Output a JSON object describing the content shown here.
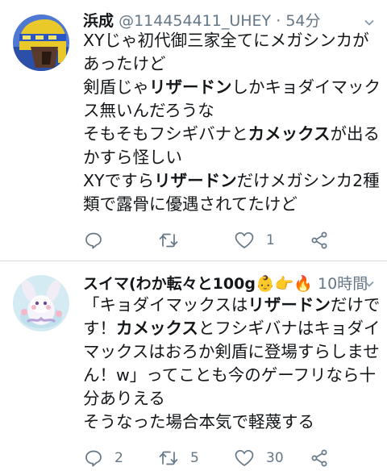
{
  "tweets": [
    {
      "name": "浜成",
      "handle": "@114454411_UHEY",
      "separator": "·",
      "time": "54分",
      "body_lines": [
        [
          {
            "t": "XYじゃ初代御三家全てにメガシンカが",
            "b": false
          }
        ],
        [
          {
            "t": "あったけど",
            "b": false
          }
        ],
        [
          {
            "t": "剣盾じゃ",
            "b": false
          },
          {
            "t": "リザードン",
            "b": true
          },
          {
            "t": "しかキョダイマック",
            "b": false
          }
        ],
        [
          {
            "t": "ス無いんだろうな",
            "b": false
          }
        ],
        [
          {
            "t": "そもそもフシギバナと",
            "b": false
          },
          {
            "t": "カメックス",
            "b": true
          },
          {
            "t": "が出る",
            "b": false
          }
        ],
        [
          {
            "t": "かすら怪しい",
            "b": false
          }
        ],
        [
          {
            "t": "XYですら",
            "b": false
          },
          {
            "t": "リザードン",
            "b": true
          },
          {
            "t": "だけメガシンカ2種",
            "b": false
          }
        ],
        [
          {
            "t": "類で露骨に優遇されてたけど",
            "b": false
          }
        ]
      ],
      "actions": {
        "reply_count": "",
        "retweet_count": "",
        "like_count": "1"
      },
      "avatar_icon": "masked-character-avatar-icon"
    },
    {
      "name": "スイマ(わか転々と100g",
      "name_emoji": [
        "👶",
        "👉",
        "🔥"
      ],
      "time": "10時間",
      "body_lines": [
        [
          {
            "t": "「キョダイマックスは",
            "b": false
          },
          {
            "t": "リザードン",
            "b": true
          },
          {
            "t": "だけで",
            "b": false
          }
        ],
        [
          {
            "t": "す！",
            "b": false
          },
          {
            "t": "カメックス",
            "b": true
          },
          {
            "t": "とフシギバナはキョダイ",
            "b": false
          }
        ],
        [
          {
            "t": "マックスはおろか剣盾に登場すらしませ",
            "b": false
          }
        ],
        [
          {
            "t": "ん！w」ってことも今のゲーフリなら十",
            "b": false
          }
        ],
        [
          {
            "t": "分ありえる",
            "b": false
          }
        ],
        [
          {
            "t": "そうなった場合本気で軽蔑する",
            "b": false
          }
        ]
      ],
      "actions": {
        "reply_count": "2",
        "retweet_count": "5",
        "like_count": "30"
      },
      "avatar_icon": "pokemon-illustration-avatar-icon"
    }
  ],
  "colors": {
    "text": "#14171a",
    "muted": "#657786",
    "divider": "#d5dbe0",
    "avatar1_bg": "#3a63c2",
    "avatar1_helmet": "#e9c829",
    "avatar2_bg": "#cfe6f1"
  }
}
